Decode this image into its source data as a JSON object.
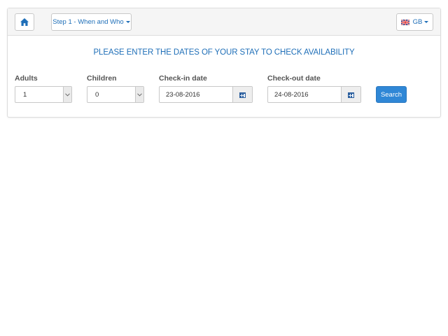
{
  "header": {
    "home_icon": "home-icon",
    "step_label": "Step 1 - When and Who",
    "language_label": "GB",
    "language_flag_icon": "uk-flag-icon"
  },
  "main": {
    "headline": "PLEASE ENTER THE DATES OF YOUR STAY TO CHECK AVAILABILITY",
    "adults": {
      "label": "Adults",
      "value": "1"
    },
    "children": {
      "label": "Children",
      "value": "0"
    },
    "checkin": {
      "label": "Check-in date",
      "value": "23-08-2016",
      "icon": "calendar-icon"
    },
    "checkout": {
      "label": "Check-out date",
      "value": "24-08-2016",
      "icon": "calendar-icon"
    },
    "search_label": "Search"
  },
  "colors": {
    "accent": "#1f6fb8",
    "primary_button": "#2f87d6",
    "header_bg": "#f5f5f5"
  }
}
